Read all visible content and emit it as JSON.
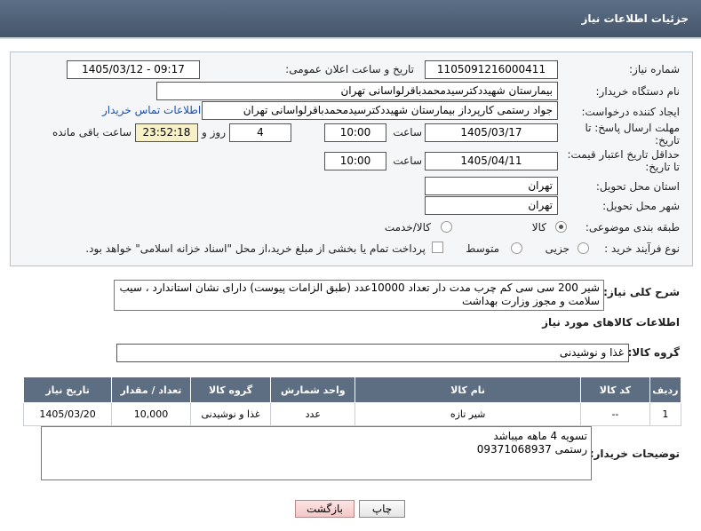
{
  "header": {
    "title": "جزئیات اطلاعات نیاز"
  },
  "form": {
    "need_number_label": "شماره نیاز:",
    "need_number": "1105091216000411",
    "announce_label": "تاریخ و ساعت اعلان عمومی:",
    "announce_value": "1405/03/12 - 09:17",
    "buyer_org_label": "نام دستگاه خریدار:",
    "buyer_org": "بیمارستان شهیددکترسیدمحمدباقرلواسانی تهران",
    "requester_label": "ایجاد کننده درخواست:",
    "requester": "جواد رستمی کارپرداز بیمارستان شهیددکترسیدمحمدباقرلواسانی تهران",
    "contact_link": "اطلاعات تماس خریدار",
    "reply_deadline_label_1": "مهلت ارسال پاسخ: تا",
    "reply_deadline_label_2": "تاریخ:",
    "reply_date": "1405/03/17",
    "time_label": "ساعت",
    "reply_time": "10:00",
    "days_value": "4",
    "days_label": "روز و",
    "remaining_time": "23:52:18",
    "remaining_label": "ساعت باقی مانده",
    "validity_label_1": "حداقل تاریخ اعتبار قیمت:",
    "validity_label_2": "تا تاریخ:",
    "validity_date": "1405/04/11",
    "validity_time": "10:00",
    "province_label": "استان محل تحویل:",
    "province": "تهران",
    "city_label": "شهر محل تحویل:",
    "city": "تهران",
    "category_label": "طبقه بندی موضوعی:",
    "category_goods": "کالا",
    "category_goods_service": "کالا/خدمت",
    "process_label": "نوع فرآیند خرید :",
    "process_partial": "جزیی",
    "process_medium": "متوسط",
    "payment_note": "پرداخت تمام یا بخشی از مبلغ خرید،از محل \"اسناد خزانه اسلامی\" خواهد بود."
  },
  "summary": {
    "label": "شرح کلی نیاز:",
    "text": "شیر 200 سی سی کم چرب مدت دار تعداد 10000عدد (طبق الزامات پیوست) دارای نشان استاندارد ، سیب سلامت و مجوز وزارت بهداشت"
  },
  "goods_info": {
    "title": "اطلاعات کالاهای مورد نیاز",
    "group_label": "گروه کالا:",
    "group_value": "غذا و نوشیدنی"
  },
  "table": {
    "headers": [
      "ردیف",
      "کد کالا",
      "نام کالا",
      "واحد شمارش",
      "گروه کالا",
      "تعداد / مقدار",
      "تاریخ نیاز"
    ],
    "rows": [
      [
        "1",
        "--",
        "شیر تازه",
        "عدد",
        "غذا و نوشیدنی",
        "10,000",
        "1405/03/20"
      ]
    ]
  },
  "buyer_notes": {
    "label": "توضیحات خریدار:",
    "line1": "تسویه 4 ماهه میباشد",
    "line2": "رستمی 09371068937"
  },
  "buttons": {
    "print": "چاپ",
    "back": "بازگشت"
  },
  "colors": {
    "header": "#4f6076",
    "table_header": "#5d6e82",
    "link": "#1a4fb5",
    "yellow": "#f8f1c8"
  }
}
